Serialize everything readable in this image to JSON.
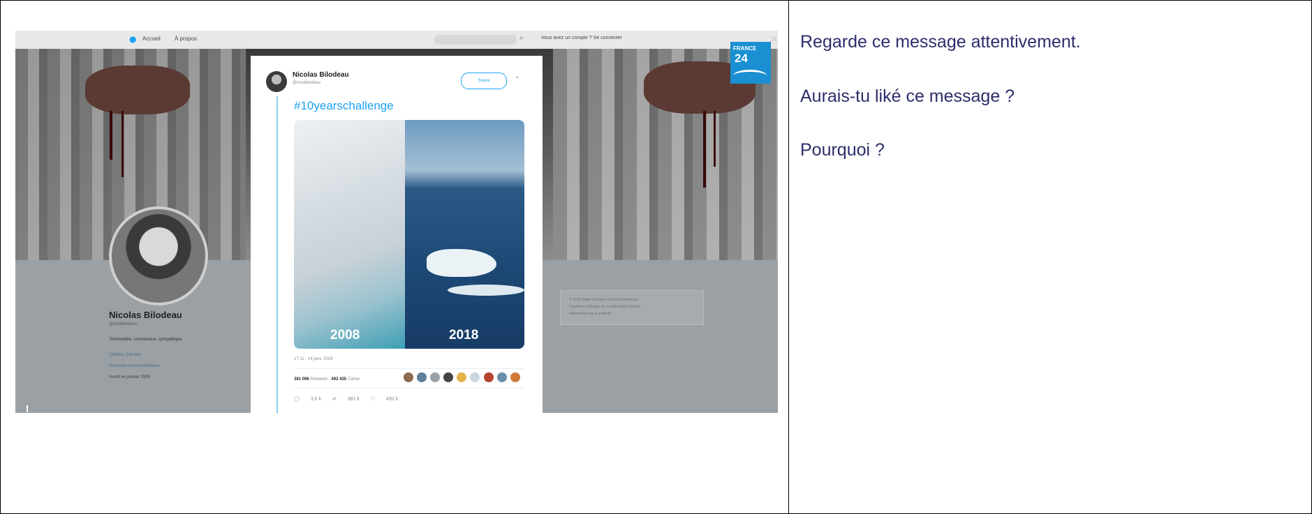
{
  "twitter": {
    "nav_home": "Accueil",
    "nav_about": "À propos",
    "login_text": "Vous avez un compte ? Se connecter"
  },
  "profile": {
    "name": "Nicolas Bilodeau",
    "handle": "@nicobilodeau",
    "bio": "Technophile, connoisseur, sympathique",
    "location": "Québec, Canada",
    "link": "facebook.com/nicobilodeau",
    "joined": "Inscrit en janvier 2009"
  },
  "side_box": {
    "line1": "© 2019 Twitter  À propos  Centre d'assistance",
    "line2": "Conditions  Politique de confidentialité  Cookies",
    "line3": "Informations sur la publicité"
  },
  "tweet": {
    "author": "Nicolas Bilodeau",
    "handle": "@nicobilodeau",
    "follow_label": "Suivre",
    "hashtag": "#10yearschallenge",
    "year_left": "2008",
    "year_right": "2018",
    "timestamp": "17:11 - 14 janv. 2019",
    "retweets": "381 096",
    "retweets_label": "Retweets",
    "likes": "492 435",
    "likes_label": "J'aime",
    "reply_count": "3,6 k",
    "retweet_count": "381 k",
    "like_count": "492 k"
  },
  "overlay": {
    "brand_line1": "FRANCE",
    "brand_line2": "24"
  },
  "questions": {
    "q1": "Regarde ce message attentivement.",
    "q2": "Aurais-tu liké ce message ?",
    "q3": "Pourquoi ?"
  },
  "colors": {
    "question_text": "#2b2e6a",
    "twitter_blue": "#1da1f2",
    "france24_blue": "#1a8fd1"
  }
}
